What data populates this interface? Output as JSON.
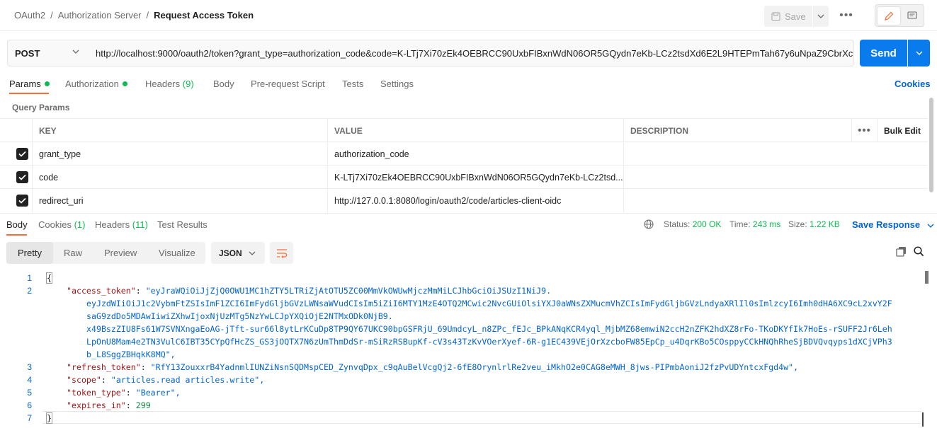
{
  "header": {
    "breadcrumb": [
      "OAuth2",
      "Authorization Server"
    ],
    "title": "Request Access Token",
    "save_label": "Save"
  },
  "request": {
    "method": "POST",
    "url": "http://localhost:9000/oauth2/token?grant_type=authorization_code&code=K-LTj7Xi70zEk4OEBRCC90UxbFIBxnWdN06OR5GQydn7eKb-LCz2tsdXd6E2L9HTEPmTah67y6uNpaZ9CbrXcFq",
    "send_label": "Send"
  },
  "tabs": {
    "params": "Params",
    "authorization": "Authorization",
    "headers": "Headers",
    "headers_count": "(9)",
    "body": "Body",
    "prerequest": "Pre-request Script",
    "tests": "Tests",
    "settings": "Settings",
    "cookies": "Cookies"
  },
  "query_params": {
    "label": "Query Params",
    "columns": {
      "key": "KEY",
      "value": "VALUE",
      "description": "DESCRIPTION",
      "bulk": "Bulk Edit"
    },
    "rows": [
      {
        "key": "grant_type",
        "value": "authorization_code",
        "description": ""
      },
      {
        "key": "code",
        "value": "K-LTj7Xi70zEk4OEBRCC90UxbFIBxnWdN06OR5GQydn7eKb-LCz2tsd...",
        "description": ""
      },
      {
        "key": "redirect_uri",
        "value": "http://127.0.0.1:8080/login/oauth2/code/articles-client-oidc",
        "description": ""
      }
    ]
  },
  "response": {
    "tabs": {
      "body": "Body",
      "cookies": "Cookies",
      "cookies_count": "(1)",
      "headers": "Headers",
      "headers_count": "(11)",
      "tests": "Test Results"
    },
    "status_label": "Status:",
    "status_value": "200 OK",
    "time_label": "Time:",
    "time_value": "243 ms",
    "size_label": "Size:",
    "size_value": "1.22 KB",
    "save_response": "Save Response",
    "formats": [
      "Pretty",
      "Raw",
      "Preview",
      "Visualize"
    ],
    "language": "JSON",
    "body": {
      "open": "{",
      "close": "}",
      "access_token_key": "\"access_token\"",
      "access_token_lines": [
        "\"eyJraWQiOiJjZjQ0OWU1MC1hZTY5LTRiZjAtOTU5ZC00MmVkOWUwMjczMmMiLCJhbGciOiJSUzI1NiJ9.",
        "eyJzdWIiOiJ1c2VybmFtZSIsImF1ZCI6ImFydGljbGVzLWNsaWVudCIsIm5iZiI6MTY1MzE4OTQ2MCwic2NvcGUiOlsiYXJ0aWNsZXMucmVhZCIsImFydGljbGVzLndyaXRlIl0sImlzcyI6Imh0dHA6XC9cL2xvY2F",
        "saG9zdDo5MDAwIiwiZXhwIjoxNjUzMTg5NzYwLCJpYXQiOjE2NTMxODk0NjB9.",
        "x49BszZIU8Fs61W7SVNXngaEoAG-jTft-sur66l8ytLrKCuDp8TP9QY67UKC90bpGSFRjU_69UmdcyL_n8ZPc_fEJc_BPkANqKCR4yql_MjbMZ68emwiN2ccH2nZFK2hdXZ8rFo-TKoDKYfIk7HoEs-rSUFF2Jr6Leh",
        "LpOnU8Mam4e2TN3VulC6IBT35CYpQfHcZS_GS3jOQTX7N6zUmThmDdSr-mSiRzRSBupKf-cV3s43TzKvVOerXyef-6R-g1EC439VEjOrXzcboFW85EpCp_u4DqrKBo5COsppyCCkHNQhRheSjBDVQvqyps1dXCjVPh3",
        "b_L8SggZBHqkK8MQ\","
      ],
      "refresh_token_key": "\"refresh_token\"",
      "refresh_token_value": "\"RfY13ZouxxrB4YadnmlIUNZiNsnSQDMspCED_ZynvqDpx_c9qAuBelVcgQj2-6fE8OrynlrlRe2veu_iMkhO2e0CAG8eMWH_8jws-PIPmbAoniJ2fzPvUDYntcxFgd4w\",",
      "scope_key": "\"scope\"",
      "scope_value": "\"articles.read articles.write\",",
      "token_type_key": "\"token_type\"",
      "token_type_value": "\"Bearer\",",
      "expires_in_key": "\"expires_in\"",
      "expires_in_value": "299",
      "line_numbers": [
        "1",
        "2",
        "3",
        "4",
        "5",
        "6",
        "7"
      ]
    }
  }
}
